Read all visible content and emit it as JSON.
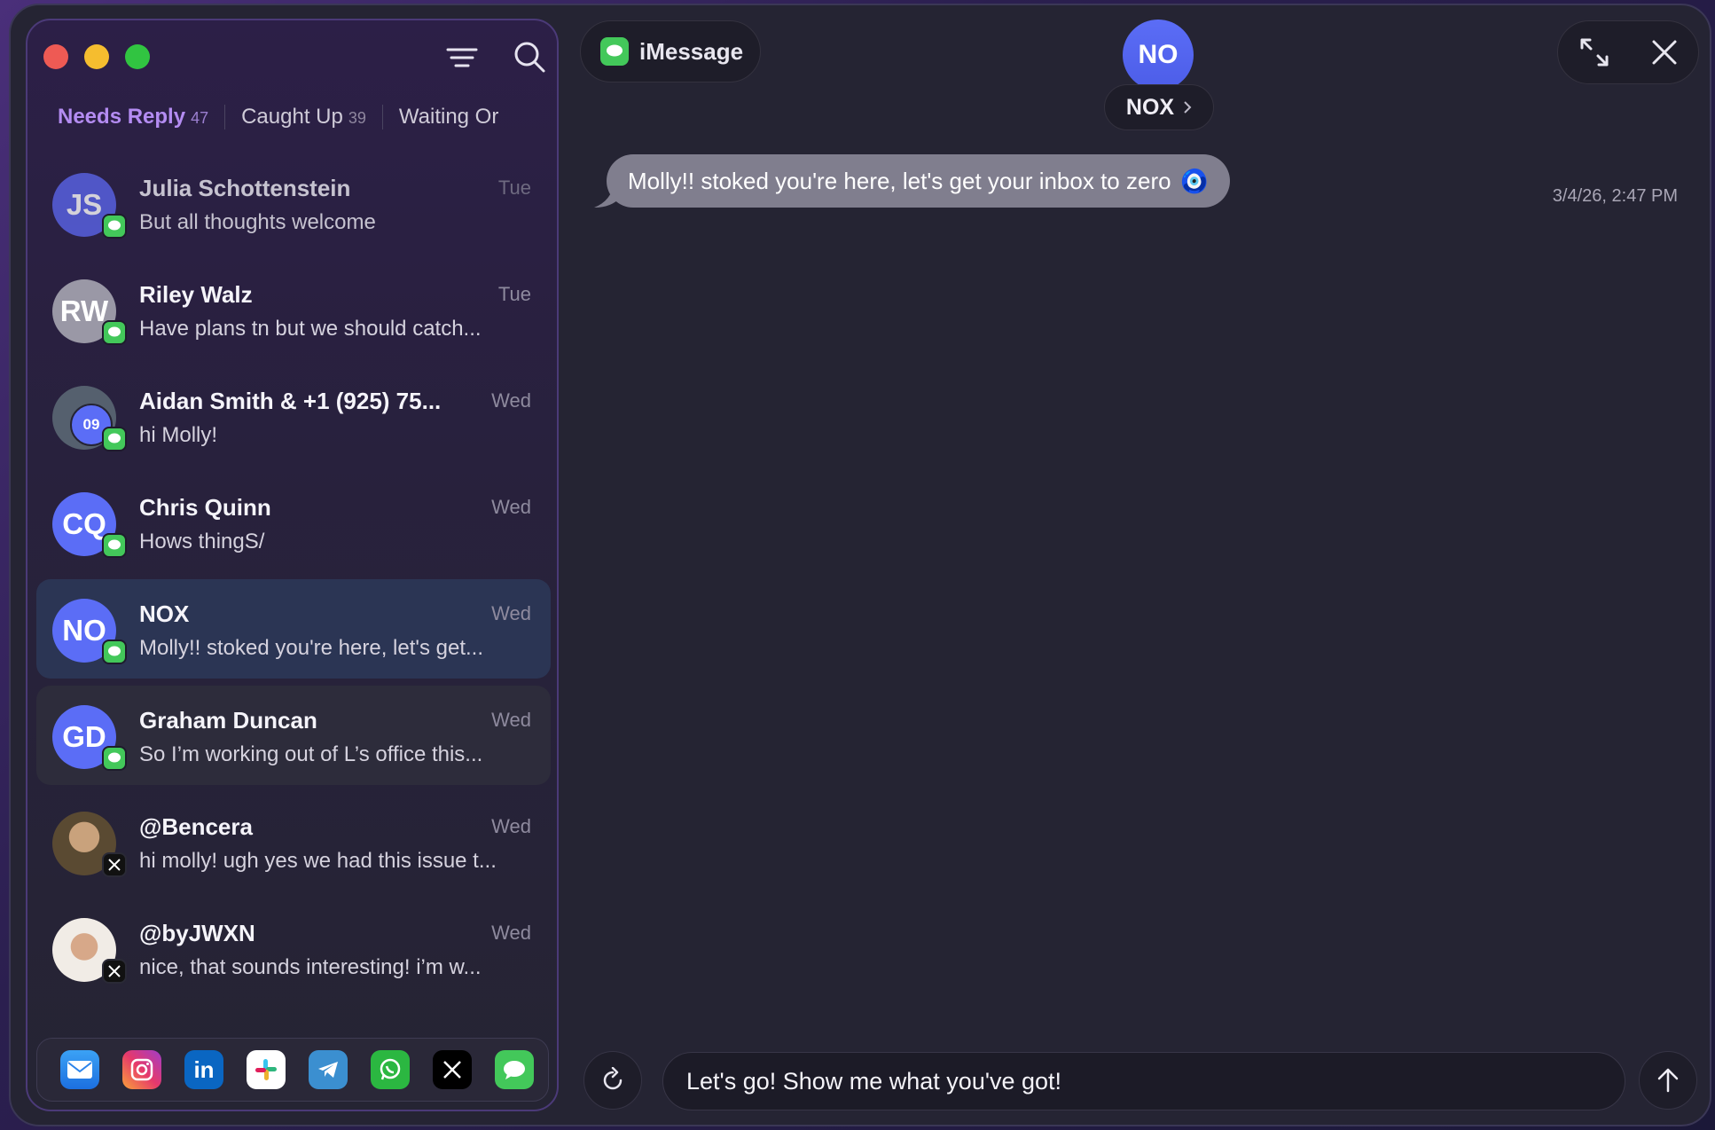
{
  "window": {
    "traffic_lights": [
      "close",
      "minimize",
      "zoom"
    ]
  },
  "sidebar": {
    "tabs": [
      {
        "label": "Needs Reply",
        "count": "47",
        "active": true
      },
      {
        "label": "Caught Up",
        "count": "39",
        "active": false
      },
      {
        "label": "Waiting Or",
        "count": "",
        "active": false
      }
    ],
    "conversations": [
      {
        "initials": "JS",
        "name": "Julia Schottenstein",
        "preview": "But all thoughts welcome",
        "day": "Tue",
        "network": "imessage",
        "avatar_color": "#5a64e8",
        "muted": true
      },
      {
        "initials": "RW",
        "name": "Riley Walz",
        "preview": "Have plans tn but we should catch...",
        "day": "Tue",
        "network": "imessage",
        "avatar_color": "#9a98a6",
        "muted": false
      },
      {
        "initials": "09",
        "name": "Aidan Smith & +1 (925) 75...",
        "preview": "hi Molly!",
        "day": "Wed",
        "network": "imessage",
        "avatar_color": "#5b6df6",
        "muted": false
      },
      {
        "initials": "CQ",
        "name": "Chris Quinn",
        "preview": "Hows thingS/",
        "day": "Wed",
        "network": "imessage",
        "avatar_color": "#5b6df6",
        "muted": false
      },
      {
        "initials": "NO",
        "name": "NOX",
        "preview": "Molly!! stoked you're here, let's get...",
        "day": "Wed",
        "network": "imessage",
        "avatar_color": "#5b6df6",
        "muted": false
      },
      {
        "initials": "GD",
        "name": "Graham Duncan",
        "preview": "So I’m working out of L’s office this...",
        "day": "Wed",
        "network": "imessage",
        "avatar_color": "#5b6df6",
        "muted": false
      },
      {
        "initials": "",
        "name": "@Bencera",
        "preview": "hi molly! ugh yes we had this issue t...",
        "day": "Wed",
        "network": "x",
        "avatar_color": "#6b5a3e",
        "muted": false
      },
      {
        "initials": "",
        "name": "@byJWXN",
        "preview": "nice, that sounds interesting! i’m w...",
        "day": "Wed",
        "network": "x",
        "avatar_color": "#d9cfc4",
        "muted": false
      }
    ],
    "dock_apps": [
      "mail-icon",
      "instagram-icon",
      "linkedin-icon",
      "slack-icon",
      "telegram-icon",
      "whatsapp-icon",
      "x-icon",
      "imessage-icon"
    ]
  },
  "header": {
    "platform": "iMessage",
    "contact_initials": "NO",
    "contact_name": "NOX"
  },
  "thread": {
    "messages": [
      {
        "text": "Molly!! stoked you're here, let's get your inbox to zero",
        "emoji": "🧿",
        "timestamp": "3/4/26, 2:47 PM",
        "direction": "incoming"
      }
    ]
  },
  "composer": {
    "value": "Let's go! Show me what you've got!"
  },
  "colors": {
    "accent": "#b48cf2",
    "avatar": "#5b6df6",
    "imessage_green": "#43c85a",
    "bubble": "#807e8e"
  }
}
